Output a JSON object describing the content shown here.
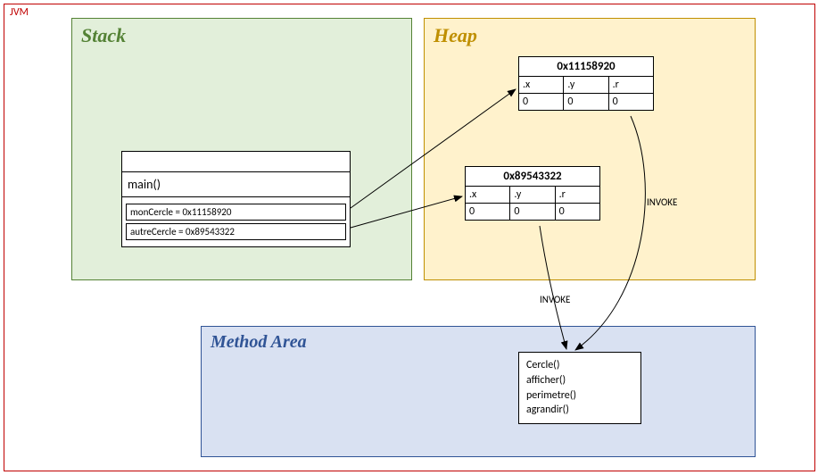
{
  "jvm_label": "JVM",
  "stack": {
    "title": "Stack",
    "frame_name": "main()",
    "vars": [
      {
        "text": "monCercle = 0x11158920"
      },
      {
        "text": "autreCercle = 0x89543322"
      }
    ]
  },
  "heap": {
    "title": "Heap",
    "objects": [
      {
        "addr": "0x11158920",
        "fields": [
          {
            "name": ".x",
            "val": "0"
          },
          {
            "name": ".y",
            "val": "0"
          },
          {
            "name": ".r",
            "val": "0"
          }
        ]
      },
      {
        "addr": "0x89543322",
        "fields": [
          {
            "name": ".x",
            "val": "0"
          },
          {
            "name": ".y",
            "val": "0"
          },
          {
            "name": ".r",
            "val": "0"
          }
        ]
      }
    ]
  },
  "method_area": {
    "title": "Method Area",
    "methods": [
      "Cercle()",
      "afficher()",
      "perimetre()",
      "agrandir()"
    ]
  },
  "labels": {
    "invoke1": "INVOKE",
    "invoke2": "INVOKE"
  }
}
